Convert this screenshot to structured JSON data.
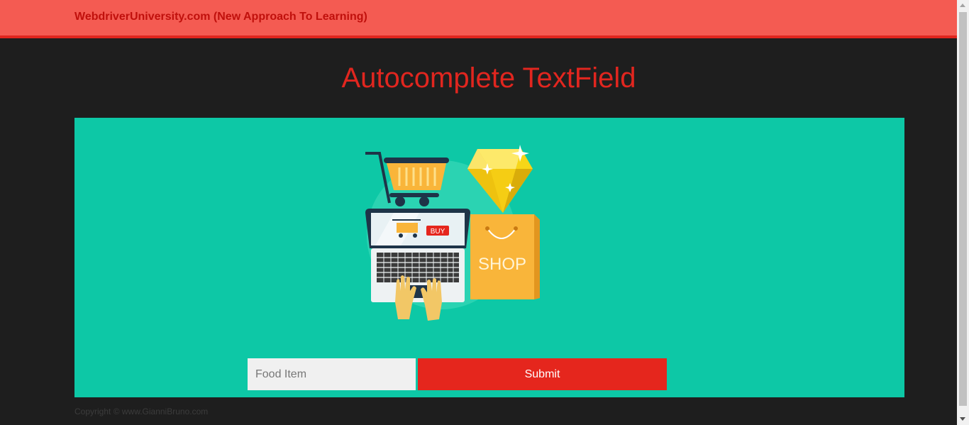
{
  "navbar": {
    "brand": "WebdriverUniversity.com (New Approach To Learning)"
  },
  "header": {
    "title": "Autocomplete TextField"
  },
  "illustration": {
    "icon": "shopping-illustration",
    "buy_label": "BUY",
    "shop_label": "SHOP"
  },
  "form": {
    "input_placeholder": "Food Item",
    "input_value": "",
    "submit_label": "Submit"
  },
  "footer": {
    "copyright": "Copyright © www.GianniBruno.com"
  },
  "colors": {
    "navbar": "#f45b52",
    "navbar_border": "#e0261e",
    "brand_text": "#c0100c",
    "title": "#e1261f",
    "panel": "#0dc8a6",
    "submit": "#e5261d",
    "page_bg": "#1e1e1e"
  }
}
